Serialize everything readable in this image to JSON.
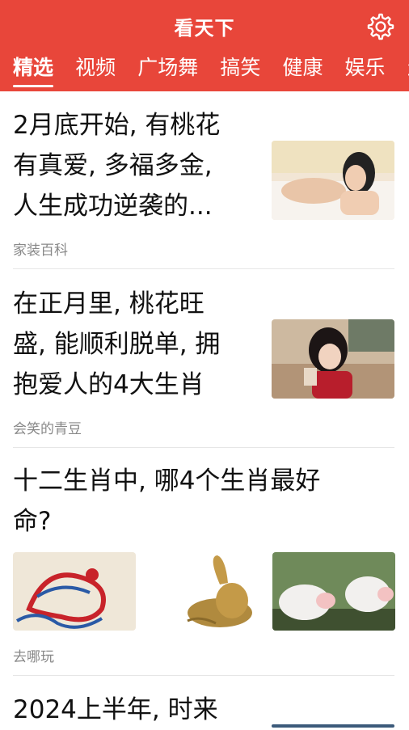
{
  "header": {
    "title": "看天下",
    "settings_icon": "gear-icon",
    "color": "#e8463a"
  },
  "tabs": [
    "精选",
    "视频",
    "广场舞",
    "搞笑",
    "健康",
    "娱乐",
    "生"
  ],
  "articles": [
    {
      "title_lines": [
        "2月底开始, 有桃花",
        "有真爱, 多福多金,",
        "人生成功逆袭的..."
      ],
      "source": "家装百科"
    },
    {
      "title_lines": [
        "在正月里, 桃花旺",
        "盛, 能顺利脱单, 拥",
        "抱爱人的4大生肖"
      ],
      "source": "会笑的青豆"
    },
    {
      "title_lines": [
        "十二生肖中, 哪4个生肖最好",
        "命?"
      ],
      "source": "去哪玩"
    },
    {
      "title_lines": [
        "2024上半年, 时来"
      ],
      "source": ""
    }
  ]
}
